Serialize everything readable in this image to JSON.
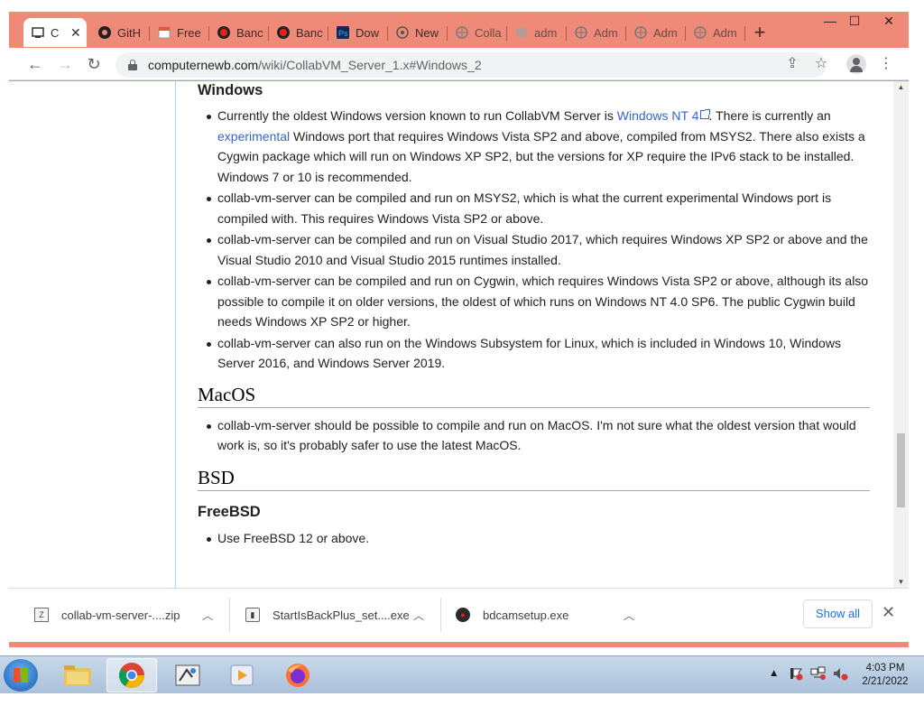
{
  "browser": {
    "tabs": [
      {
        "label": "C",
        "icon": "collabvm-icon",
        "active": true
      },
      {
        "label": "GitH",
        "icon": "github-icon"
      },
      {
        "label": "Free",
        "icon": "page-icon"
      },
      {
        "label": "Banc",
        "icon": "record-icon"
      },
      {
        "label": "Banc",
        "icon": "record-icon"
      },
      {
        "label": "Dow",
        "icon": "ps-icon"
      },
      {
        "label": "New",
        "icon": "globe-icon"
      },
      {
        "label": "Colla",
        "icon": "globe-icon"
      },
      {
        "label": "adm",
        "icon": "globe-icon"
      },
      {
        "label": "Adm",
        "icon": "globe-icon"
      },
      {
        "label": "Adm",
        "icon": "globe-icon"
      },
      {
        "label": "Adm",
        "icon": "globe-icon"
      }
    ],
    "url_host": "computernewb.com",
    "url_path": "/wiki/CollabVM_Server_1.x#Windows_2"
  },
  "article": {
    "windows_heading": "Windows",
    "windows_items": {
      "i1_a": "Currently the oldest Windows version known to run CollabVM Server is ",
      "i1_link1": "Windows NT 4",
      "i1_b": ". There is currently an ",
      "i1_link2": "experimental",
      "i1_c": " Windows port that requires Windows Vista SP2 and above, compiled from MSYS2. There also exists a Cygwin package which will run on Windows XP SP2, but the versions for XP require the IPv6 stack to be installed. Windows 7 or 10 is recommended.",
      "i2": "collab-vm-server can be compiled and run on MSYS2, which is what the current experimental Windows port is compiled with. This requires Windows Vista SP2 or above.",
      "i3": "collab-vm-server can be compiled and run on Visual Studio 2017, which requires Windows XP SP2 or above and the Visual Studio 2010 and Visual Studio 2015 runtimes installed.",
      "i4": "collab-vm-server can be compiled and run on Cygwin, which requires Windows Vista SP2 or above, although its also possible to compile it on older versions, the oldest of which runs on Windows NT 4.0 SP6. The public Cygwin build needs Windows XP SP2 or higher.",
      "i5": "collab-vm-server can also run on the Windows Subsystem for Linux, which is included in Windows 10, Windows Server 2016, and Windows Server 2019."
    },
    "macos_heading": "MacOS",
    "macos_item": "collab-vm-server should be possible to compile and run on MacOS. I'm not sure what the oldest version that would work is, so it's probably safer to use the latest MacOS.",
    "bsd_heading": "BSD",
    "freebsd_heading": "FreeBSD",
    "freebsd_item": "Use FreeBSD 12 or above."
  },
  "downloads": {
    "items": [
      {
        "name": "collab-vm-server-....zip",
        "icon": "zip-icon"
      },
      {
        "name": "StartIsBackPlus_set....exe",
        "icon": "exe-icon"
      },
      {
        "name": "bdcamsetup.exe",
        "icon": "bandicam-icon"
      }
    ],
    "show_all": "Show all"
  },
  "taskbar": {
    "time": "4:03 PM",
    "date": "2/21/2022"
  },
  "colors": {
    "chrome_frame": "#f08a78",
    "link": "#3366cc",
    "show_all": "#1a73e8"
  }
}
